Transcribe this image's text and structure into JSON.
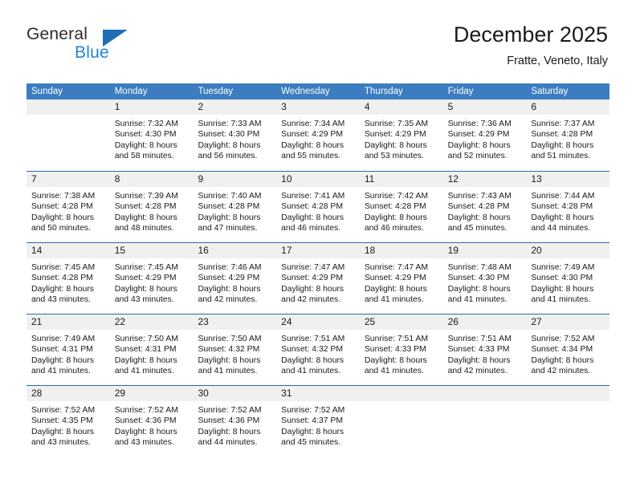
{
  "logo": {
    "word_one": "General",
    "word_two": "Blue",
    "triangle_color": "#1e6fb6",
    "blue_text_color": "#1e88d2"
  },
  "header": {
    "title": "December 2025",
    "subtitle": "Fratte, Veneto, Italy"
  },
  "theme": {
    "header_row_bg": "#3b7dc0",
    "week_separator": "#2c6aa8",
    "daynum_bg": "#f0f0f0"
  },
  "weekday_headers": [
    "Sunday",
    "Monday",
    "Tuesday",
    "Wednesday",
    "Thursday",
    "Friday",
    "Saturday"
  ],
  "weeks": [
    [
      {
        "day": "",
        "l1": "",
        "l2": "",
        "l3": "",
        "l4": ""
      },
      {
        "day": "1",
        "l1": "Sunrise: 7:32 AM",
        "l2": "Sunset: 4:30 PM",
        "l3": "Daylight: 8 hours",
        "l4": "and 58 minutes."
      },
      {
        "day": "2",
        "l1": "Sunrise: 7:33 AM",
        "l2": "Sunset: 4:30 PM",
        "l3": "Daylight: 8 hours",
        "l4": "and 56 minutes."
      },
      {
        "day": "3",
        "l1": "Sunrise: 7:34 AM",
        "l2": "Sunset: 4:29 PM",
        "l3": "Daylight: 8 hours",
        "l4": "and 55 minutes."
      },
      {
        "day": "4",
        "l1": "Sunrise: 7:35 AM",
        "l2": "Sunset: 4:29 PM",
        "l3": "Daylight: 8 hours",
        "l4": "and 53 minutes."
      },
      {
        "day": "5",
        "l1": "Sunrise: 7:36 AM",
        "l2": "Sunset: 4:29 PM",
        "l3": "Daylight: 8 hours",
        "l4": "and 52 minutes."
      },
      {
        "day": "6",
        "l1": "Sunrise: 7:37 AM",
        "l2": "Sunset: 4:28 PM",
        "l3": "Daylight: 8 hours",
        "l4": "and 51 minutes."
      }
    ],
    [
      {
        "day": "7",
        "l1": "Sunrise: 7:38 AM",
        "l2": "Sunset: 4:28 PM",
        "l3": "Daylight: 8 hours",
        "l4": "and 50 minutes."
      },
      {
        "day": "8",
        "l1": "Sunrise: 7:39 AM",
        "l2": "Sunset: 4:28 PM",
        "l3": "Daylight: 8 hours",
        "l4": "and 48 minutes."
      },
      {
        "day": "9",
        "l1": "Sunrise: 7:40 AM",
        "l2": "Sunset: 4:28 PM",
        "l3": "Daylight: 8 hours",
        "l4": "and 47 minutes."
      },
      {
        "day": "10",
        "l1": "Sunrise: 7:41 AM",
        "l2": "Sunset: 4:28 PM",
        "l3": "Daylight: 8 hours",
        "l4": "and 46 minutes."
      },
      {
        "day": "11",
        "l1": "Sunrise: 7:42 AM",
        "l2": "Sunset: 4:28 PM",
        "l3": "Daylight: 8 hours",
        "l4": "and 46 minutes."
      },
      {
        "day": "12",
        "l1": "Sunrise: 7:43 AM",
        "l2": "Sunset: 4:28 PM",
        "l3": "Daylight: 8 hours",
        "l4": "and 45 minutes."
      },
      {
        "day": "13",
        "l1": "Sunrise: 7:44 AM",
        "l2": "Sunset: 4:28 PM",
        "l3": "Daylight: 8 hours",
        "l4": "and 44 minutes."
      }
    ],
    [
      {
        "day": "14",
        "l1": "Sunrise: 7:45 AM",
        "l2": "Sunset: 4:28 PM",
        "l3": "Daylight: 8 hours",
        "l4": "and 43 minutes."
      },
      {
        "day": "15",
        "l1": "Sunrise: 7:45 AM",
        "l2": "Sunset: 4:29 PM",
        "l3": "Daylight: 8 hours",
        "l4": "and 43 minutes."
      },
      {
        "day": "16",
        "l1": "Sunrise: 7:46 AM",
        "l2": "Sunset: 4:29 PM",
        "l3": "Daylight: 8 hours",
        "l4": "and 42 minutes."
      },
      {
        "day": "17",
        "l1": "Sunrise: 7:47 AM",
        "l2": "Sunset: 4:29 PM",
        "l3": "Daylight: 8 hours",
        "l4": "and 42 minutes."
      },
      {
        "day": "18",
        "l1": "Sunrise: 7:47 AM",
        "l2": "Sunset: 4:29 PM",
        "l3": "Daylight: 8 hours",
        "l4": "and 41 minutes."
      },
      {
        "day": "19",
        "l1": "Sunrise: 7:48 AM",
        "l2": "Sunset: 4:30 PM",
        "l3": "Daylight: 8 hours",
        "l4": "and 41 minutes."
      },
      {
        "day": "20",
        "l1": "Sunrise: 7:49 AM",
        "l2": "Sunset: 4:30 PM",
        "l3": "Daylight: 8 hours",
        "l4": "and 41 minutes."
      }
    ],
    [
      {
        "day": "21",
        "l1": "Sunrise: 7:49 AM",
        "l2": "Sunset: 4:31 PM",
        "l3": "Daylight: 8 hours",
        "l4": "and 41 minutes."
      },
      {
        "day": "22",
        "l1": "Sunrise: 7:50 AM",
        "l2": "Sunset: 4:31 PM",
        "l3": "Daylight: 8 hours",
        "l4": "and 41 minutes."
      },
      {
        "day": "23",
        "l1": "Sunrise: 7:50 AM",
        "l2": "Sunset: 4:32 PM",
        "l3": "Daylight: 8 hours",
        "l4": "and 41 minutes."
      },
      {
        "day": "24",
        "l1": "Sunrise: 7:51 AM",
        "l2": "Sunset: 4:32 PM",
        "l3": "Daylight: 8 hours",
        "l4": "and 41 minutes."
      },
      {
        "day": "25",
        "l1": "Sunrise: 7:51 AM",
        "l2": "Sunset: 4:33 PM",
        "l3": "Daylight: 8 hours",
        "l4": "and 41 minutes."
      },
      {
        "day": "26",
        "l1": "Sunrise: 7:51 AM",
        "l2": "Sunset: 4:33 PM",
        "l3": "Daylight: 8 hours",
        "l4": "and 42 minutes."
      },
      {
        "day": "27",
        "l1": "Sunrise: 7:52 AM",
        "l2": "Sunset: 4:34 PM",
        "l3": "Daylight: 8 hours",
        "l4": "and 42 minutes."
      }
    ],
    [
      {
        "day": "28",
        "l1": "Sunrise: 7:52 AM",
        "l2": "Sunset: 4:35 PM",
        "l3": "Daylight: 8 hours",
        "l4": "and 43 minutes."
      },
      {
        "day": "29",
        "l1": "Sunrise: 7:52 AM",
        "l2": "Sunset: 4:36 PM",
        "l3": "Daylight: 8 hours",
        "l4": "and 43 minutes."
      },
      {
        "day": "30",
        "l1": "Sunrise: 7:52 AM",
        "l2": "Sunset: 4:36 PM",
        "l3": "Daylight: 8 hours",
        "l4": "and 44 minutes."
      },
      {
        "day": "31",
        "l1": "Sunrise: 7:52 AM",
        "l2": "Sunset: 4:37 PM",
        "l3": "Daylight: 8 hours",
        "l4": "and 45 minutes."
      },
      {
        "day": "",
        "l1": "",
        "l2": "",
        "l3": "",
        "l4": ""
      },
      {
        "day": "",
        "l1": "",
        "l2": "",
        "l3": "",
        "l4": ""
      },
      {
        "day": "",
        "l1": "",
        "l2": "",
        "l3": "",
        "l4": ""
      }
    ]
  ]
}
